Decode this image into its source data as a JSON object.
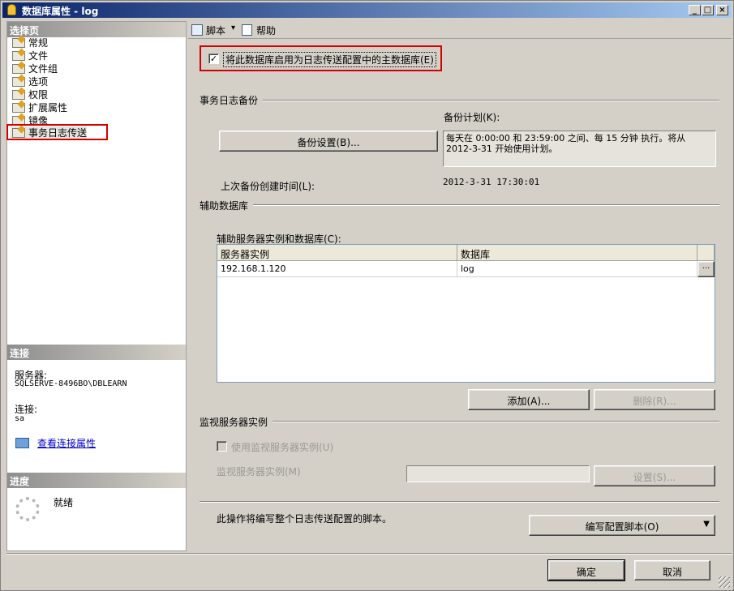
{
  "window": {
    "title": "数据库属性 - log",
    "minimize": "_",
    "maximize": "□",
    "close": "×"
  },
  "sidebar": {
    "select_page_header": "选择页",
    "items": [
      {
        "label": "常规"
      },
      {
        "label": "文件"
      },
      {
        "label": "文件组"
      },
      {
        "label": "选项"
      },
      {
        "label": "权限"
      },
      {
        "label": "扩展属性"
      },
      {
        "label": "镜像"
      },
      {
        "label": "事务日志传送",
        "selected": true
      }
    ],
    "connection_header": "连接",
    "server_label": "服务器:",
    "server_value": "SQLSERVE-8496BO\\DBLEARN",
    "connection_label": "连接:",
    "connection_value": "sa",
    "view_conn_link": "查看连接属性",
    "progress_header": "进度",
    "progress_status": "就绪"
  },
  "toolbar": {
    "script_label": "脚本",
    "script_arrow": "▾",
    "help_label": "帮助"
  },
  "main": {
    "enable_primary_checkbox": {
      "label": "将此数据库启用为日志传送配置中的主数据库(E)",
      "checked": true
    },
    "tx_backup_group": "事务日志备份",
    "backup_schedule_label": "备份计划(K):",
    "backup_settings_button": "备份设置(B)...",
    "backup_schedule_text": "每天在 0:00:00 和 23:59:00 之间、每 15 分钟 执行。将从 2012-3-31 开始使用计划。",
    "last_backup_label": "上次备份创建时间(L):",
    "last_backup_value": "2012-3-31 17:30:01",
    "secondary_group": "辅助数据库",
    "secondary_list_label": "辅助服务器实例和数据库(C):",
    "grid": {
      "columns": [
        "服务器实例",
        "数据库"
      ],
      "rows": [
        {
          "server": "192.168.1.120",
          "database": "log",
          "action": "..."
        }
      ]
    },
    "add_button": "添加(A)...",
    "remove_button": "删除(R)...",
    "monitor_group": "监视服务器实例",
    "use_monitor_checkbox": {
      "label": "使用监视服务器实例(U)",
      "checked": false
    },
    "monitor_instance_label": "监视服务器实例(M)",
    "monitor_instance_value": "",
    "monitor_settings_button": "设置(S)...",
    "script_hint": "此操作将编写整个日志传送配置的脚本。",
    "script_config_button": "编写配置脚本(O)",
    "script_config_arrow": "▼"
  },
  "footer": {
    "ok_button": "确定",
    "cancel_button": "取消"
  },
  "colors": {
    "titlebar_start": "#0a246a",
    "titlebar_end": "#a6caf0",
    "highlight_box": "#d40000",
    "window_bg": "#d4d0c8"
  }
}
